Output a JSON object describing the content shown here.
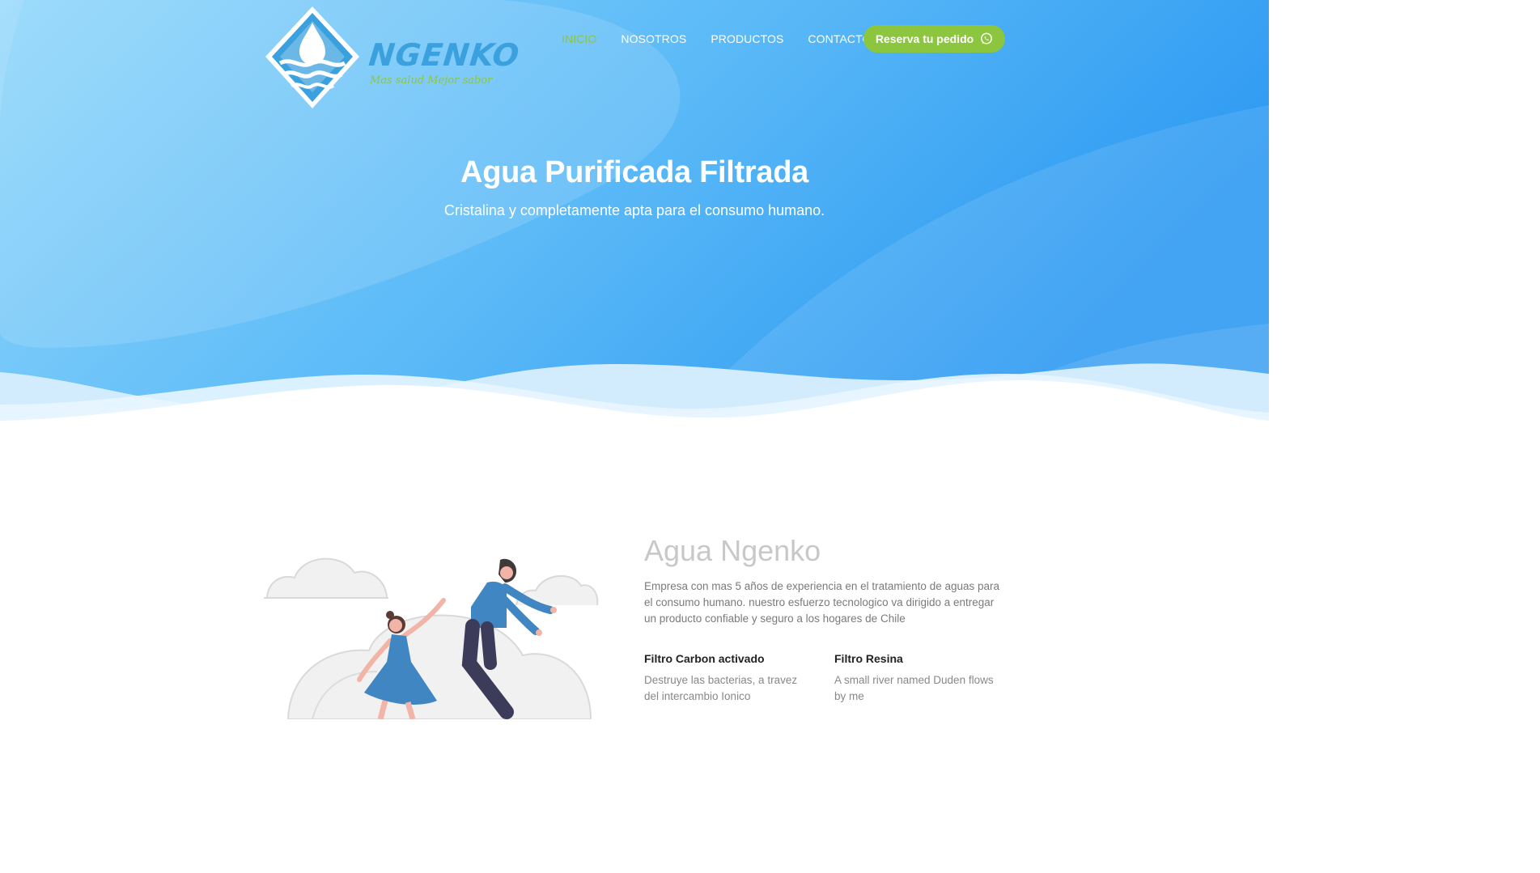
{
  "brand": {
    "name": "NGENKO",
    "tagline": "Mas salud Mejor sabor"
  },
  "nav": {
    "items": [
      {
        "label": "INICIO",
        "active": true
      },
      {
        "label": "NOSOTROS",
        "active": false
      },
      {
        "label": "PRODUCTOS",
        "active": false
      },
      {
        "label": "CONTACTO",
        "active": false
      }
    ],
    "cta_label": "Reserva tu pedido",
    "cta_icon": "whatsapp-icon"
  },
  "hero": {
    "title": "Agua Purificada Filtrada",
    "subtitle": "Cristalina y completamente apta para el consumo humano."
  },
  "about": {
    "title": "Agua Ngenko",
    "description": "Empresa con mas 5 años de experiencia en el tratamiento de aguas para el consumo humano. nuestro esfuerzo tecnologico va dirigido a entregar un producto confiable y seguro a los hogares de Chile",
    "features": [
      {
        "title": "Filtro Carbon activado",
        "description": "Destruye las bacterias, a travez del intercambio Ionico"
      },
      {
        "title": "Filtro Resina",
        "description": "A small river named Duden flows by me"
      }
    ]
  },
  "colors": {
    "accent": "#8cc63f",
    "hero_blue_light": "#8fd6fa",
    "hero_blue_dark": "#2f9cf2",
    "logo_blue": "#3aa0de"
  }
}
